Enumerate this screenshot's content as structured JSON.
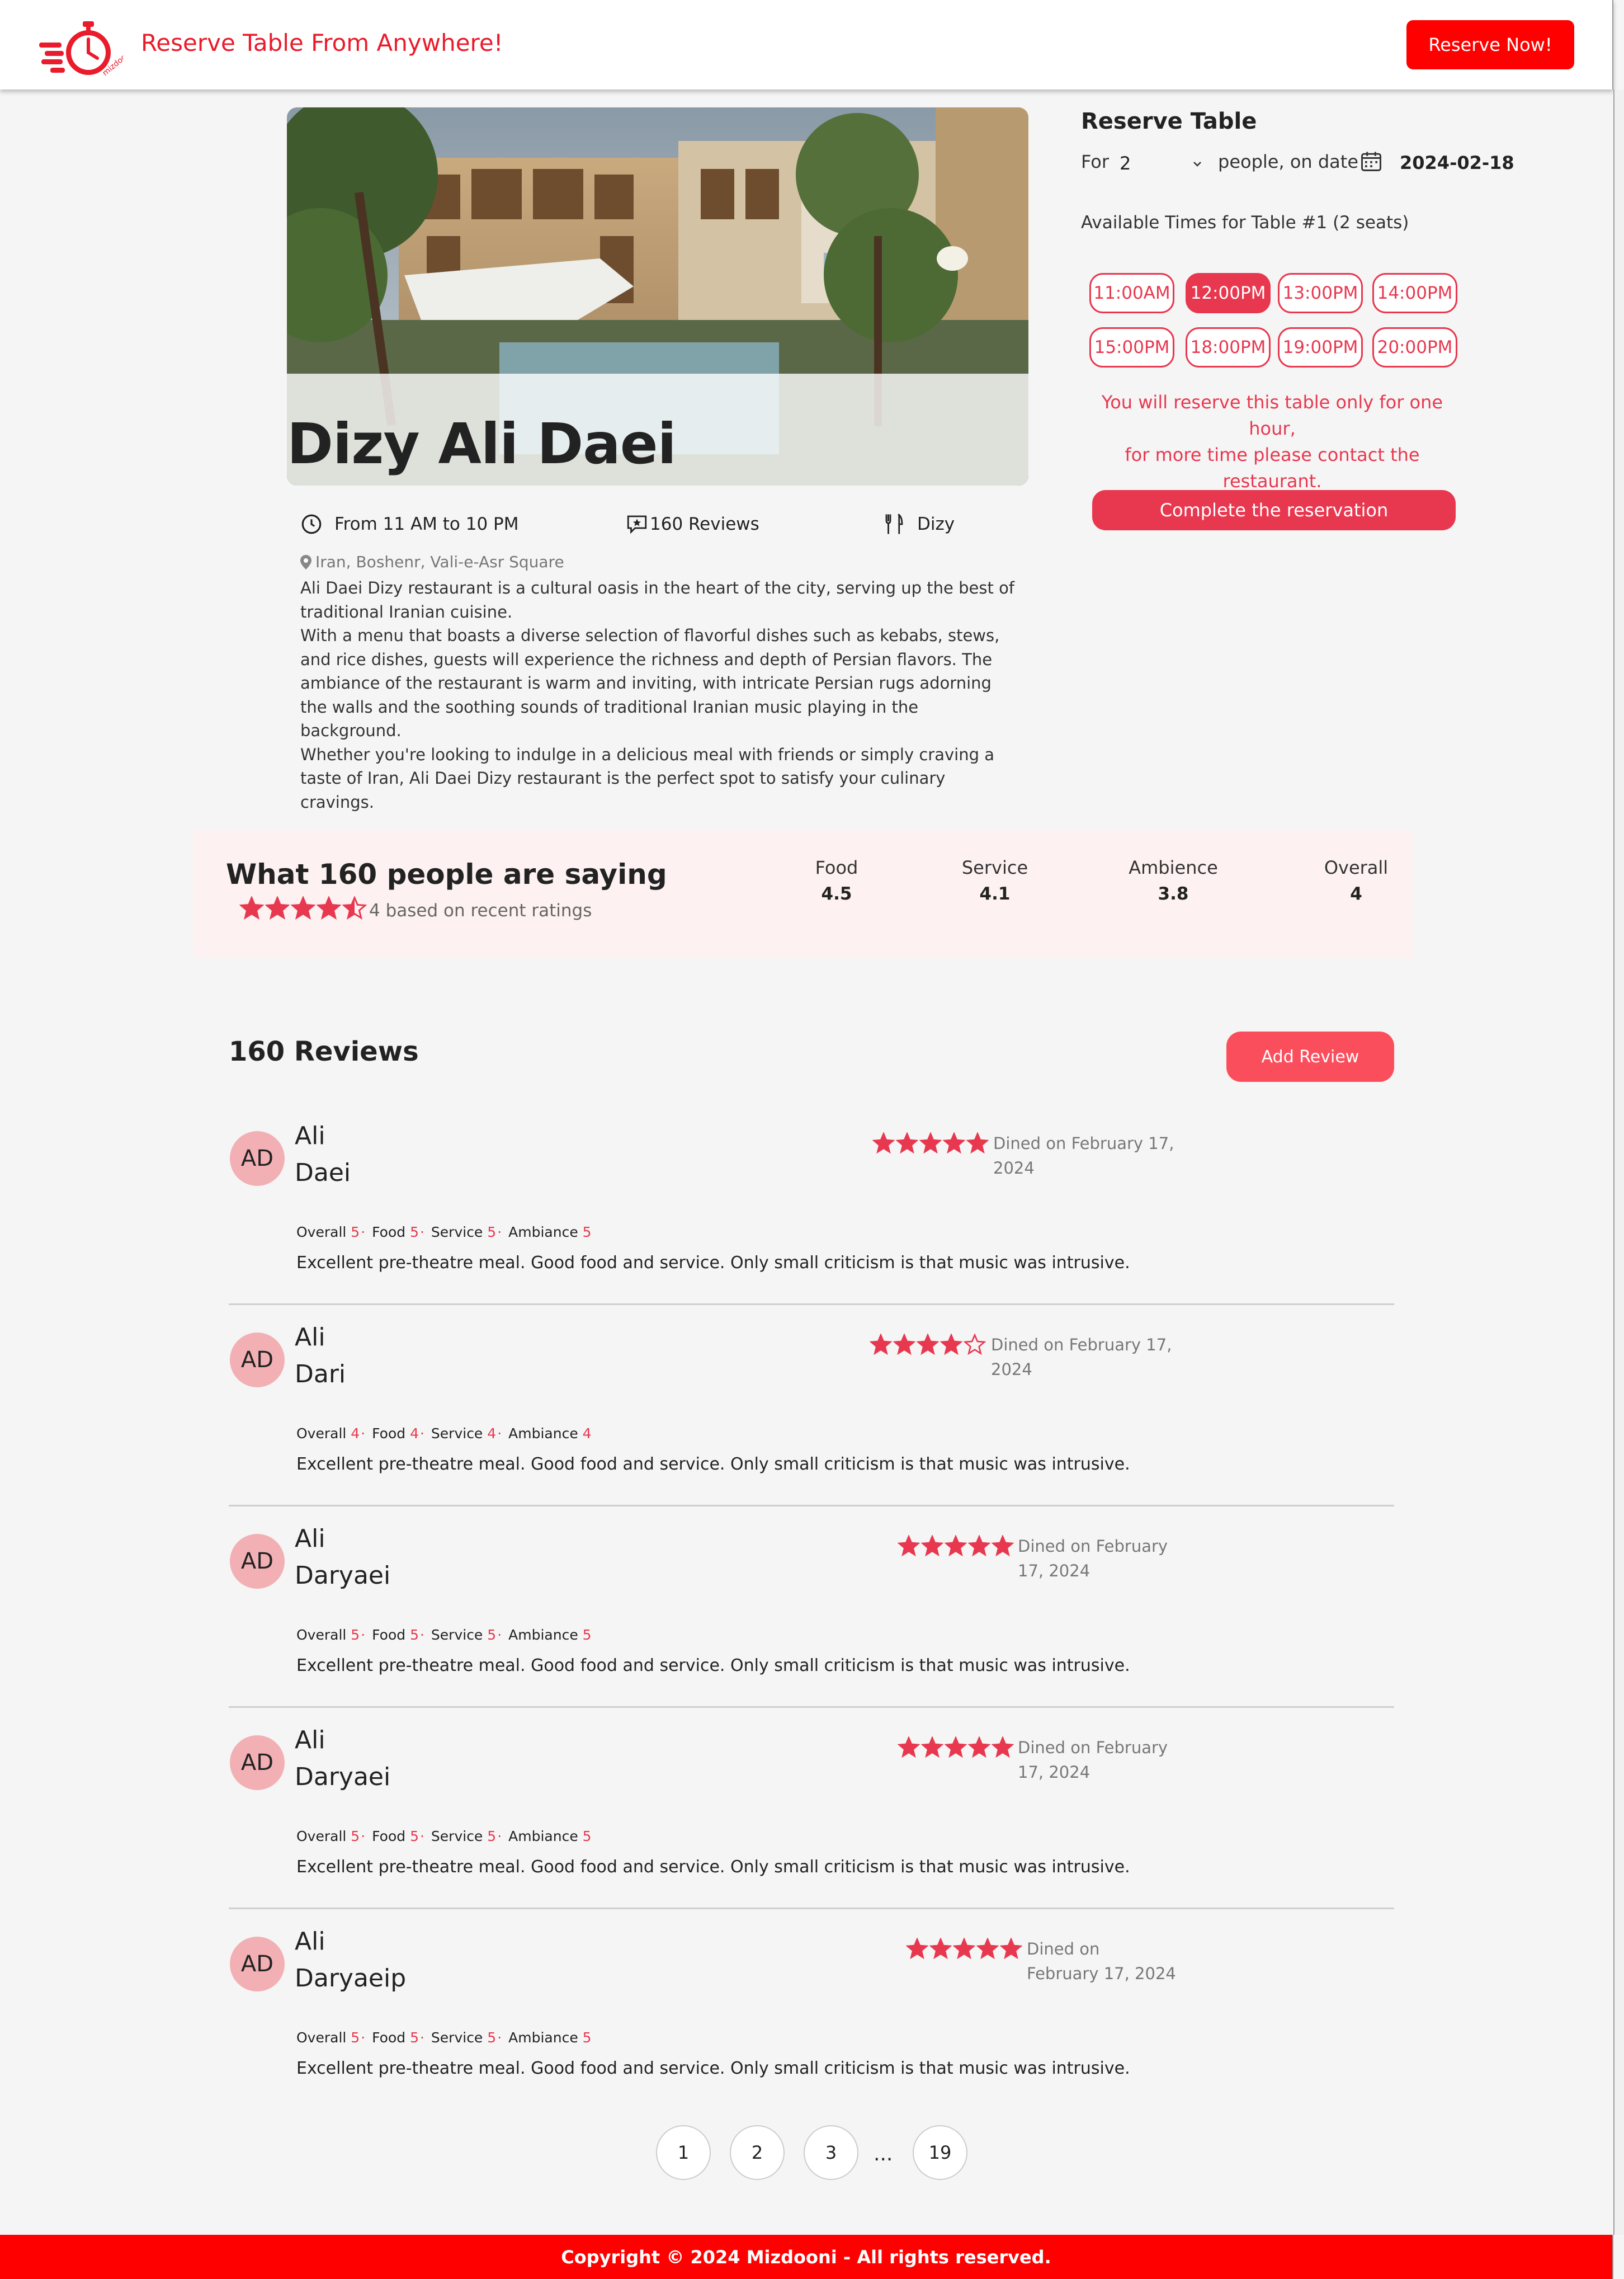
{
  "header": {
    "title": "Reserve Table From Anywhere!",
    "reserve_button": "Reserve Now!",
    "logo_icon": "mizdooni-clock-logo"
  },
  "restaurant": {
    "name": "Dizy Ali Daei",
    "hours": "From 11 AM to 10 PM",
    "reviews_count_label": "160 Reviews",
    "type": "Dizy",
    "location": "Iran, Boshenr, Vali-e-Asr Square",
    "description": [
      "Ali Daei Dizy restaurant is a cultural oasis in the heart of the city, serving up the best of traditional Iranian cuisine.",
      "With a menu that boasts a diverse selection of flavorful dishes such as kebabs, stews, and rice dishes, guests will experience the richness and depth of Persian flavors. The ambiance of the restaurant is warm and inviting, with intricate Persian rugs adorning the walls and the soothing sounds of traditional Iranian music playing in the background.",
      "Whether you're looking to indulge in a delicious meal with friends or simply craving a taste of Iran, Ali Daei Dizy restaurant is the perfect spot to satisfy your culinary cravings."
    ]
  },
  "reserve": {
    "title": "Reserve Table",
    "for_label": "For",
    "people_value": "2",
    "on_date_label": "people, on date",
    "date": "2024-02-18",
    "available_label": "Available Times for Table #1 (2 seats)",
    "times": [
      {
        "label": "11:00AM",
        "selected": false
      },
      {
        "label": "12:00PM",
        "selected": true
      },
      {
        "label": "13:00PM",
        "selected": false
      },
      {
        "label": "14:00PM",
        "selected": false
      },
      {
        "label": "15:00PM",
        "selected": false
      },
      {
        "label": "18:00PM",
        "selected": false
      },
      {
        "label": "19:00PM",
        "selected": false
      },
      {
        "label": "20:00PM",
        "selected": false
      }
    ],
    "warning_lines": [
      "You will reserve this table only for one hour,",
      "for more time please contact the",
      "restaurant."
    ],
    "complete_button": "Complete the reservation"
  },
  "summary": {
    "title": "What 160 people are saying",
    "stars": 4.5,
    "basis": "4 based on recent ratings",
    "metrics": [
      {
        "label": "Food",
        "value": "4.5"
      },
      {
        "label": "Service",
        "value": "4.1"
      },
      {
        "label": "Ambience",
        "value": "3.8"
      },
      {
        "label": "Overall",
        "value": "4"
      }
    ]
  },
  "reviews": {
    "title": "160 Reviews",
    "add_button": "Add Review",
    "items": [
      {
        "initials": "AD",
        "first": "Ali",
        "last": "Daei",
        "stars": 5,
        "dined": [
          "Dined on February 17,",
          "2024"
        ],
        "overall": "5",
        "food": "5",
        "service": "5",
        "ambiance": "5",
        "text": "Excellent pre-theatre meal. Good food and service. Only small criticism is that music was intrusive."
      },
      {
        "initials": "AD",
        "first": "Ali",
        "last": "Dari",
        "stars": 4,
        "dined": [
          "Dined on February 17,",
          "2024"
        ],
        "overall": "4",
        "food": "4",
        "service": "4",
        "ambiance": "4",
        "text": "Excellent pre-theatre meal. Good food and service. Only small criticism is that music was intrusive."
      },
      {
        "initials": "AD",
        "first": "Ali",
        "last": "Daryaei",
        "stars": 5,
        "dined": [
          "Dined on February",
          "17, 2024"
        ],
        "overall": "5",
        "food": "5",
        "service": "5",
        "ambiance": "5",
        "text": "Excellent pre-theatre meal. Good food and service. Only small criticism is that music was intrusive."
      },
      {
        "initials": "AD",
        "first": "Ali",
        "last": "Daryaei",
        "stars": 5,
        "dined": [
          "Dined on February",
          "17, 2024"
        ],
        "overall": "5",
        "food": "5",
        "service": "5",
        "ambiance": "5",
        "text": "Excellent pre-theatre meal. Good food and service. Only small criticism is that music was intrusive."
      },
      {
        "initials": "AD",
        "first": "Ali",
        "last": "Daryaeip",
        "stars": 5,
        "dined": [
          "Dined on",
          "February 17, 2024"
        ],
        "overall": "5",
        "food": "5",
        "service": "5",
        "ambiance": "5",
        "text": "Excellent pre-theatre meal. Good food and service. Only small criticism is that music was intrusive."
      }
    ],
    "score_labels": {
      "overall": "Overall",
      "food": "Food",
      "service": "Service",
      "ambiance": "Ambiance"
    }
  },
  "pagination": {
    "pages": [
      "1",
      "2",
      "3"
    ],
    "ellipsis": "...",
    "last": "19"
  },
  "footer": {
    "copyright": "Copyright © 2024 Mizdooni - All rights reserved."
  },
  "colors": {
    "brand_red": "#ff0000",
    "accent": "#e8384f",
    "summary_bg": "#fdf1f1",
    "avatar_bg": "#f2b0b4"
  }
}
